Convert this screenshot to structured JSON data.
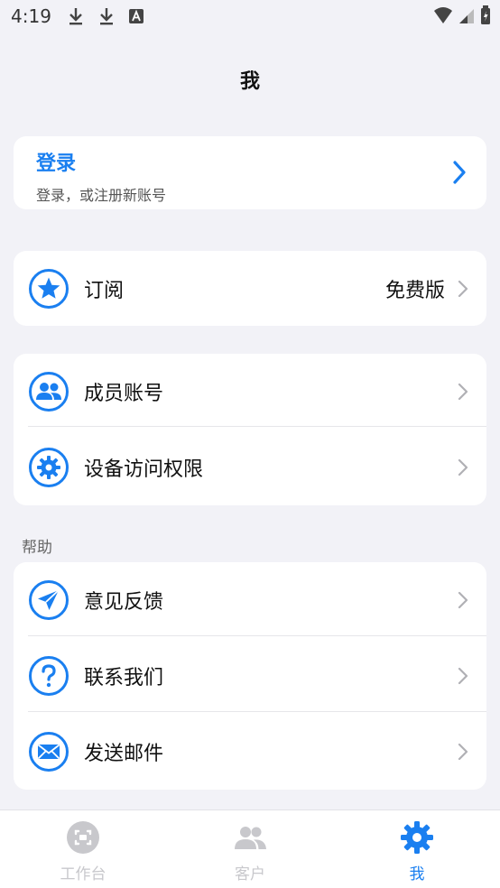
{
  "status": {
    "time": "4:19"
  },
  "header": {
    "title": "我"
  },
  "login": {
    "title": "登录",
    "subtitle": "登录，或注册新账号"
  },
  "subscription": {
    "label": "订阅",
    "value": "免费版"
  },
  "account_group": {
    "items": [
      {
        "label": "成员账号",
        "icon": "members-icon"
      },
      {
        "label": "设备访问权限",
        "icon": "gear-icon"
      }
    ]
  },
  "help": {
    "section_label": "帮助",
    "items": [
      {
        "label": "意见反馈",
        "icon": "paper-plane-icon"
      },
      {
        "label": "联系我们",
        "icon": "question-icon"
      },
      {
        "label": "发送邮件",
        "icon": "mail-icon"
      }
    ]
  },
  "tabbar": {
    "tabs": [
      {
        "label": "工作台",
        "active": false
      },
      {
        "label": "客户",
        "active": false
      },
      {
        "label": "我",
        "active": true
      }
    ]
  },
  "colors": {
    "accent": "#1a7ff0",
    "background": "#f2f2f7",
    "inactive": "#c8c8cc"
  }
}
